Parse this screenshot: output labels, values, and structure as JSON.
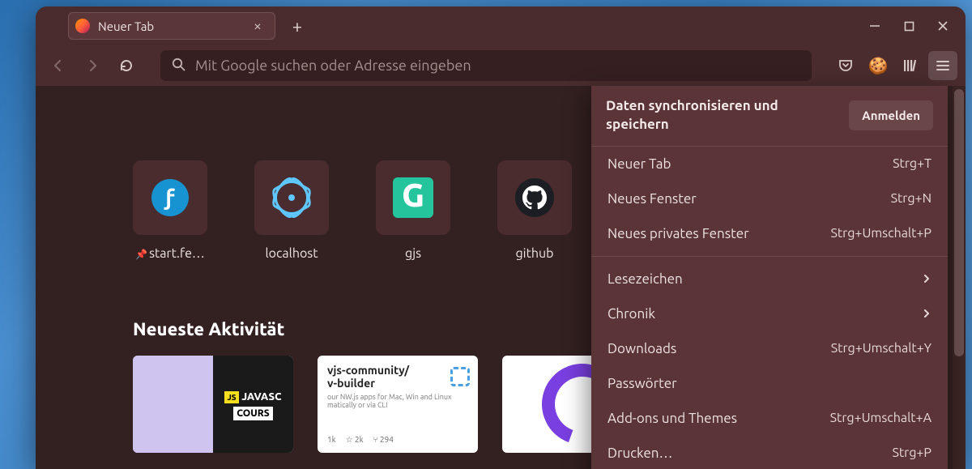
{
  "window": {
    "tab_title": "Neuer Tab",
    "newtab_glyph": "+",
    "close_glyph": "×"
  },
  "toolbar": {
    "url_placeholder": "Mit Google suchen oder Adresse eingeben"
  },
  "shortcuts": [
    {
      "label": "start.fe…",
      "pinned": true,
      "icon": "fedora"
    },
    {
      "label": "localhost",
      "pinned": false,
      "icon": "react"
    },
    {
      "label": "gjs",
      "pinned": false,
      "icon": "g"
    },
    {
      "label": "github",
      "pinned": false,
      "icon": "github"
    }
  ],
  "sections": {
    "recent_title": "Neueste Aktivität"
  },
  "highlights": {
    "card1": {
      "badge": "JS",
      "line1": "JAVASC",
      "line2": "COURS"
    },
    "card2": {
      "line1": "vjs-community/",
      "line2": "v-builder",
      "desc": "our NW.js apps for Mac, Win and Linux  matically or via CLI",
      "stats_stars": "2k",
      "stats_forks": "294",
      "lang": "1k"
    },
    "card3": {}
  },
  "menu": {
    "header_text": "Daten synchronisieren und speichern",
    "signin_label": "Anmelden",
    "items": [
      {
        "label": "Neuer Tab",
        "shortcut": "Strg+T",
        "submenu": false
      },
      {
        "label": "Neues Fenster",
        "shortcut": "Strg+N",
        "submenu": false
      },
      {
        "label": "Neues privates Fenster",
        "shortcut": "Strg+Umschalt+P",
        "submenu": false
      },
      {
        "sep": true
      },
      {
        "label": "Lesezeichen",
        "shortcut": "",
        "submenu": true
      },
      {
        "label": "Chronik",
        "shortcut": "",
        "submenu": true
      },
      {
        "label": "Downloads",
        "shortcut": "Strg+Umschalt+Y",
        "submenu": false
      },
      {
        "label": "Passwörter",
        "shortcut": "",
        "submenu": false
      },
      {
        "label": "Add-ons und Themes",
        "shortcut": "Strg+Umschalt+A",
        "submenu": false
      },
      {
        "label": "Drucken…",
        "shortcut": "Strg+P",
        "submenu": false
      }
    ]
  }
}
